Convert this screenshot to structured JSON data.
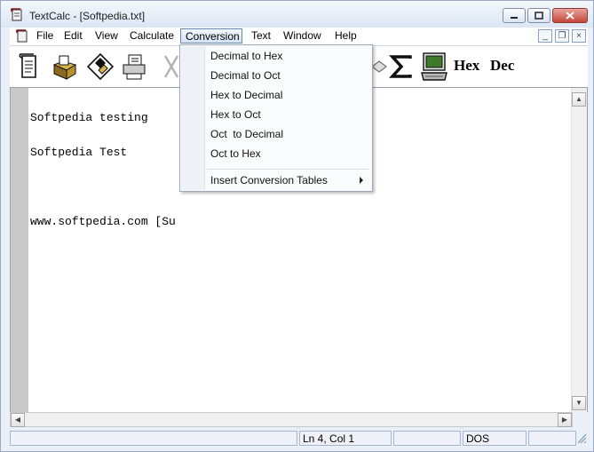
{
  "window": {
    "title": "TextCalc - [Softpedia.txt]"
  },
  "menubar": {
    "items": [
      "File",
      "Edit",
      "View",
      "Calculate",
      "Conversion",
      "Text",
      "Window",
      "Help"
    ],
    "active": "Conversion"
  },
  "toolbar": {
    "hex_label": "Hex",
    "dec_label": "Dec"
  },
  "conversion_menu": {
    "items": [
      "Decimal to Hex",
      "Decimal to Oct",
      "Hex to Decimal",
      "Hex to Oct",
      "Oct  to Decimal",
      "Oct to Hex"
    ],
    "submenu_label": "Insert Conversion Tables"
  },
  "editor": {
    "lines": [
      "Softpedia testing",
      "Softpedia Test",
      "",
      "www.softpedia.com [Su"
    ]
  },
  "statusbar": {
    "position": "Ln 4, Col 1",
    "line_ending": "DOS"
  },
  "icons": {
    "app": "app-scroll-icon",
    "new": "new-document-icon",
    "open": "open-folder-icon",
    "save": "save-disk-icon",
    "print": "printer-icon",
    "cut": "scissors-icon",
    "sum": "sigma-icon",
    "calc": "computer-calculator-icon"
  }
}
